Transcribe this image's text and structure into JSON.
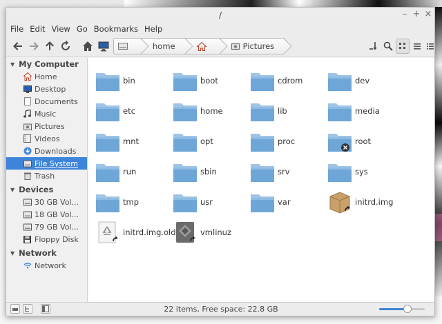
{
  "window": {
    "title": "/",
    "controls": [
      "–",
      "+",
      "×"
    ]
  },
  "menu": [
    "File",
    "Edit",
    "View",
    "Go",
    "Bookmarks",
    "Help"
  ],
  "breadcrumbs": [
    "",
    "home",
    "",
    "Pictures"
  ],
  "sidebar": {
    "sections": [
      {
        "heading": "My Computer",
        "items": [
          {
            "label": "Home",
            "icon": "home-icon"
          },
          {
            "label": "Desktop",
            "icon": "desktop-icon"
          },
          {
            "label": "Documents",
            "icon": "documents-icon"
          },
          {
            "label": "Music",
            "icon": "music-icon"
          },
          {
            "label": "Pictures",
            "icon": "pictures-icon"
          },
          {
            "label": "Videos",
            "icon": "videos-icon"
          },
          {
            "label": "Downloads",
            "icon": "downloads-icon"
          },
          {
            "label": "File System",
            "icon": "filesystem-icon",
            "selected": true
          },
          {
            "label": "Trash",
            "icon": "trash-icon"
          }
        ]
      },
      {
        "heading": "Devices",
        "items": [
          {
            "label": "30 GB Vol...",
            "icon": "drive-icon"
          },
          {
            "label": "18 GB Vol...",
            "icon": "drive-icon"
          },
          {
            "label": "79 GB Vol...",
            "icon": "drive-icon"
          },
          {
            "label": "Floppy Disk",
            "icon": "floppy-icon"
          }
        ]
      },
      {
        "heading": "Network",
        "items": [
          {
            "label": "Network",
            "icon": "network-icon"
          }
        ]
      }
    ]
  },
  "files": [
    {
      "name": "bin",
      "type": "folder"
    },
    {
      "name": "boot",
      "type": "folder"
    },
    {
      "name": "cdrom",
      "type": "folder"
    },
    {
      "name": "dev",
      "type": "folder"
    },
    {
      "name": "etc",
      "type": "folder"
    },
    {
      "name": "home",
      "type": "folder"
    },
    {
      "name": "lib",
      "type": "folder"
    },
    {
      "name": "media",
      "type": "folder"
    },
    {
      "name": "mnt",
      "type": "folder"
    },
    {
      "name": "opt",
      "type": "folder"
    },
    {
      "name": "proc",
      "type": "folder"
    },
    {
      "name": "root",
      "type": "folder-locked"
    },
    {
      "name": "run",
      "type": "folder"
    },
    {
      "name": "sbin",
      "type": "folder"
    },
    {
      "name": "srv",
      "type": "folder"
    },
    {
      "name": "sys",
      "type": "folder"
    },
    {
      "name": "tmp",
      "type": "folder"
    },
    {
      "name": "usr",
      "type": "folder"
    },
    {
      "name": "var",
      "type": "folder"
    },
    {
      "name": "initrd.img",
      "type": "package-link"
    },
    {
      "name": "initrd.img.old",
      "type": "recycle-link"
    },
    {
      "name": "vmlinuz",
      "type": "binary-link"
    }
  ],
  "status": {
    "text": "22 items, Free space: 22.8 GB",
    "zoom_fraction": 0.62
  },
  "colors": {
    "accent": "#3d84da",
    "folder": "#7fb3e0"
  }
}
